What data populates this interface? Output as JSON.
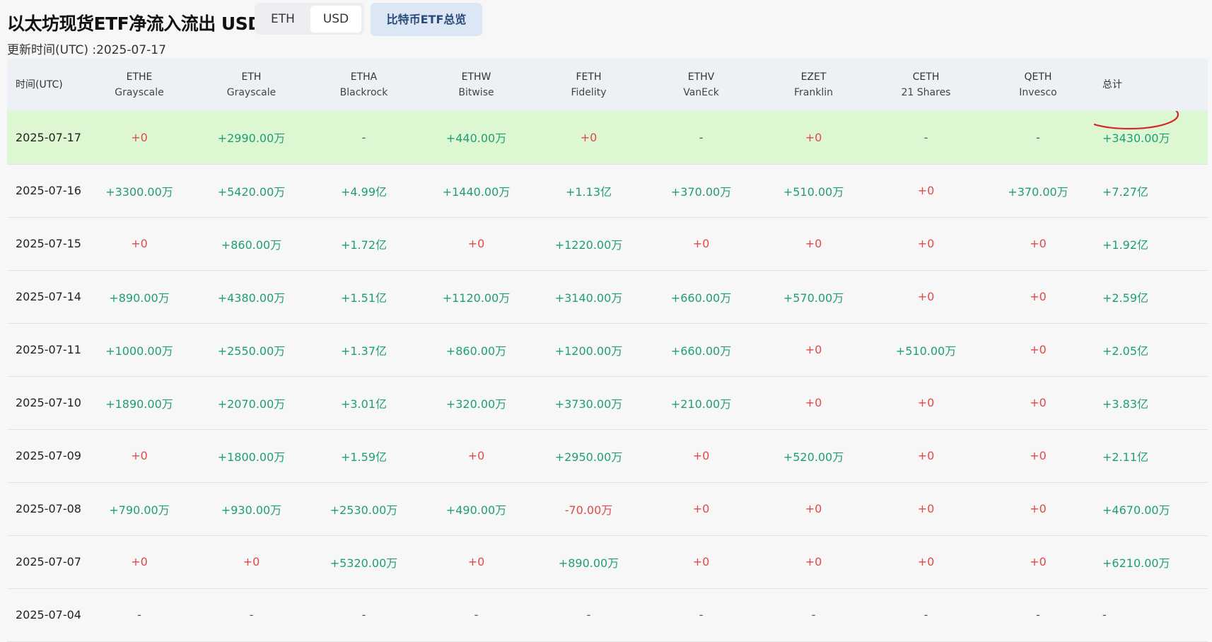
{
  "header": {
    "title": "以太坊现货ETF净流入流出 USD",
    "unit_options": [
      "ETH",
      "USD"
    ],
    "selected_unit": "USD",
    "overview_button": "比特币ETF总览",
    "update_label": "更新时间(UTC) :",
    "update_date": "2025-07-17"
  },
  "colors": {
    "positive": "#1f9e75",
    "zero_or_negative": "#e24848",
    "highlight_row": "#dcf7d2",
    "annotation_circle": "#d42a2a"
  },
  "table": {
    "date_header": "时间(UTC)",
    "total_header": "总计",
    "funds": [
      {
        "ticker": "ETHE",
        "issuer": "Grayscale"
      },
      {
        "ticker": "ETH",
        "issuer": "Grayscale"
      },
      {
        "ticker": "ETHA",
        "issuer": "Blackrock"
      },
      {
        "ticker": "ETHW",
        "issuer": "Bitwise"
      },
      {
        "ticker": "FETH",
        "issuer": "Fidelity"
      },
      {
        "ticker": "ETHV",
        "issuer": "VanEck"
      },
      {
        "ticker": "EZET",
        "issuer": "Franklin"
      },
      {
        "ticker": "CETH",
        "issuer": "21 Shares"
      },
      {
        "ticker": "QETH",
        "issuer": "Invesco"
      }
    ],
    "rows": [
      {
        "date": "2025-07-17",
        "highlight": true,
        "values": [
          "+0",
          "+2990.00万",
          "-",
          "+440.00万",
          "+0",
          "-",
          "+0",
          "-",
          "-"
        ],
        "total": "+3430.00万"
      },
      {
        "date": "2025-07-16",
        "values": [
          "+3300.00万",
          "+5420.00万",
          "+4.99亿",
          "+1440.00万",
          "+1.13亿",
          "+370.00万",
          "+510.00万",
          "+0",
          "+370.00万"
        ],
        "total": "+7.27亿"
      },
      {
        "date": "2025-07-15",
        "values": [
          "+0",
          "+860.00万",
          "+1.72亿",
          "+0",
          "+1220.00万",
          "+0",
          "+0",
          "+0",
          "+0"
        ],
        "total": "+1.92亿"
      },
      {
        "date": "2025-07-14",
        "values": [
          "+890.00万",
          "+4380.00万",
          "+1.51亿",
          "+1120.00万",
          "+3140.00万",
          "+660.00万",
          "+570.00万",
          "+0",
          "+0"
        ],
        "total": "+2.59亿"
      },
      {
        "date": "2025-07-11",
        "values": [
          "+1000.00万",
          "+2550.00万",
          "+1.37亿",
          "+860.00万",
          "+1200.00万",
          "+660.00万",
          "+0",
          "+510.00万",
          "+0"
        ],
        "total": "+2.05亿"
      },
      {
        "date": "2025-07-10",
        "values": [
          "+1890.00万",
          "+2070.00万",
          "+3.01亿",
          "+320.00万",
          "+3730.00万",
          "+210.00万",
          "+0",
          "+0",
          "+0"
        ],
        "total": "+3.83亿"
      },
      {
        "date": "2025-07-09",
        "values": [
          "+0",
          "+1800.00万",
          "+1.59亿",
          "+0",
          "+2950.00万",
          "+0",
          "+520.00万",
          "+0",
          "+0"
        ],
        "total": "+2.11亿"
      },
      {
        "date": "2025-07-08",
        "values": [
          "+790.00万",
          "+930.00万",
          "+2530.00万",
          "+490.00万",
          "-70.00万",
          "+0",
          "+0",
          "+0",
          "+0"
        ],
        "total": "+4670.00万"
      },
      {
        "date": "2025-07-07",
        "values": [
          "+0",
          "+0",
          "+5320.00万",
          "+0",
          "+890.00万",
          "+0",
          "+0",
          "+0",
          "+0"
        ],
        "total": "+6210.00万"
      },
      {
        "date": "2025-07-04",
        "values": [
          "-",
          "-",
          "-",
          "-",
          "-",
          "-",
          "-",
          "-",
          "-"
        ],
        "total": "-"
      }
    ]
  }
}
